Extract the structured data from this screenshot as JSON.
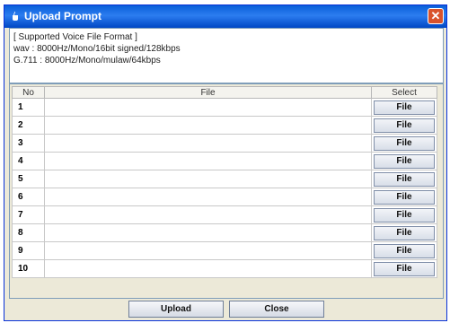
{
  "window": {
    "title": "Upload Prompt",
    "close_glyph": "✕"
  },
  "info": {
    "lines": [
      "[ Supported Voice File Format ]",
      "wav : 8000Hz/Mono/16bit signed/128kbps",
      "G.711 : 8000Hz/Mono/mulaw/64kbps"
    ]
  },
  "table": {
    "headers": {
      "no": "No",
      "file": "File",
      "select": "Select"
    },
    "rows": [
      {
        "no": "1",
        "file": "",
        "button": "File"
      },
      {
        "no": "2",
        "file": "",
        "button": "File"
      },
      {
        "no": "3",
        "file": "",
        "button": "File"
      },
      {
        "no": "4",
        "file": "",
        "button": "File"
      },
      {
        "no": "5",
        "file": "",
        "button": "File"
      },
      {
        "no": "6",
        "file": "",
        "button": "File"
      },
      {
        "no": "7",
        "file": "",
        "button": "File"
      },
      {
        "no": "8",
        "file": "",
        "button": "File"
      },
      {
        "no": "9",
        "file": "",
        "button": "File"
      },
      {
        "no": "10",
        "file": "",
        "button": "File"
      }
    ]
  },
  "footer": {
    "upload_label": "Upload",
    "close_label": "Close"
  }
}
